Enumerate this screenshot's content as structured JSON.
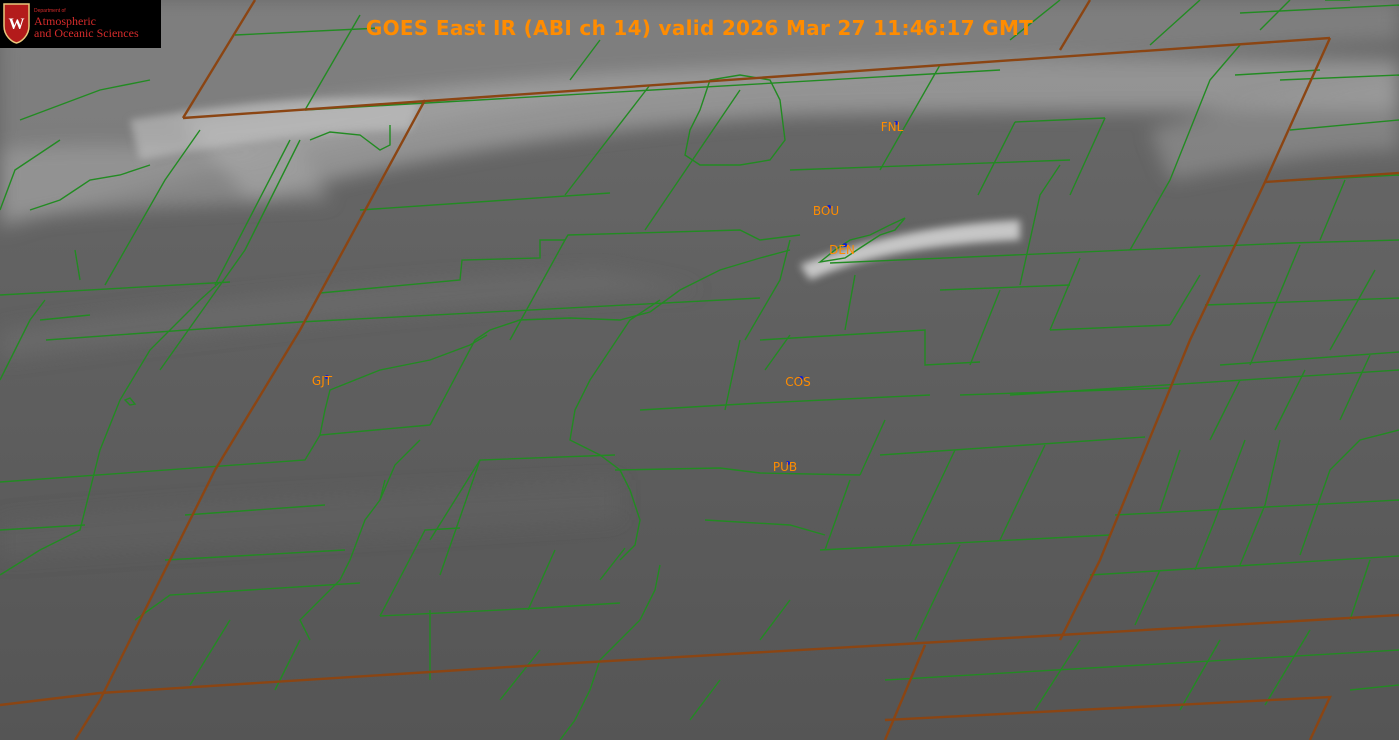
{
  "title": "GOES East IR (ABI ch 14) valid 2026 Mar 27 11:46:17 GMT",
  "logo": {
    "small_text": "Department of",
    "line1": "Atmospheric",
    "line2": "and Oceanic Sciences",
    "crest_letter": "W",
    "icon": "uw-crest-icon"
  },
  "stations": [
    {
      "id": "FNL"
    },
    {
      "id": "BOU"
    },
    {
      "id": "DEN"
    },
    {
      "id": "GJT"
    },
    {
      "id": "COS"
    },
    {
      "id": "PUB"
    }
  ],
  "colors": {
    "county_lines": "#228b22",
    "state_lines": "#8b4513",
    "label": "#ff8c00",
    "station_marker": "#1020d0",
    "background": "#5c5c5c"
  }
}
